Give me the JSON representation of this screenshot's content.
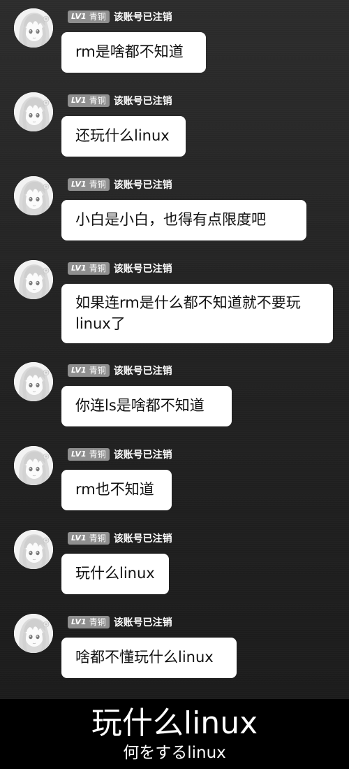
{
  "user": {
    "level_badge": "LV1",
    "level_name": "青铜",
    "display_name": "该账号已注销",
    "avatar_icon": "anime-girl-avatar-icon"
  },
  "messages": [
    {
      "text": "rm是啥都不知道"
    },
    {
      "text": "还玩什么linux"
    },
    {
      "text": "小白是小白，也得有点限度吧"
    },
    {
      "text": "如果连rm是什么都不知道就不要玩linux了"
    },
    {
      "text": "你连ls是啥都不知道"
    },
    {
      "text": "rm也不知道"
    },
    {
      "text": "玩什么linux"
    },
    {
      "text": "啥都不懂玩什么linux"
    }
  ],
  "caption": {
    "main": "玩什么linux",
    "sub": "何をするlinux"
  },
  "colors": {
    "background": "#222222",
    "bubble": "#ffffff",
    "badge": "#8f8f8f",
    "footer": "#000000"
  }
}
